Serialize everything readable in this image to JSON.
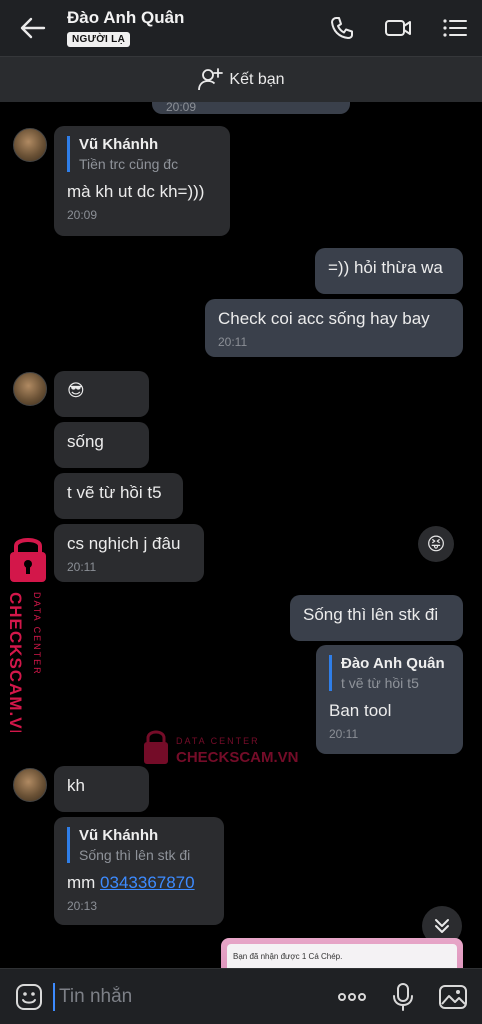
{
  "header": {
    "contact_name": "Đào Anh Quân",
    "badge": "NGƯỜI LẠ"
  },
  "friend_bar": {
    "label": "Kết bạn"
  },
  "messages": {
    "partial_top_time": "20:09",
    "m1": {
      "quote_name": "Vũ Khánhh",
      "quote_text": "Tiền trc cũng đc",
      "text": "mà kh ut dc kh=)))",
      "time": "20:09"
    },
    "m2": {
      "text": "=)) hỏi thừa wa"
    },
    "m3": {
      "text": "Check coi acc sống hay bay",
      "time": "20:11"
    },
    "m4": {
      "text": "😎"
    },
    "m5": {
      "text": "sống"
    },
    "m6": {
      "text": "t vẽ từ hồi t5"
    },
    "m7": {
      "text": "cs nghịch j đâu",
      "time": "20:11"
    },
    "m8": {
      "text": "Sống thì lên stk đi"
    },
    "m9": {
      "quote_name": "Đào Anh Quân",
      "quote_text": "t vẽ từ hồi t5",
      "text": "Ban tool",
      "time": "20:11"
    },
    "m10": {
      "text": "kh"
    },
    "m11": {
      "quote_name": "Vũ Khánhh",
      "quote_text": "Sống thì lên stk đi",
      "prefix": "mm ",
      "phone": "0343367870",
      "time": "20:13"
    },
    "partial_card_text": "Bạn đã nhận được 1 Cá Chép."
  },
  "reaction": {
    "emoji": "😝"
  },
  "watermark": {
    "line1": "DATA CENTER",
    "line2": "CHECKSCAM.VN"
  },
  "composer": {
    "placeholder": "Tin nhắn"
  },
  "colors": {
    "accent": "#2f7ee8",
    "watermark": "#d3174a",
    "out_bubble": "#3a404b",
    "in_bubble": "#2b2c2f"
  }
}
